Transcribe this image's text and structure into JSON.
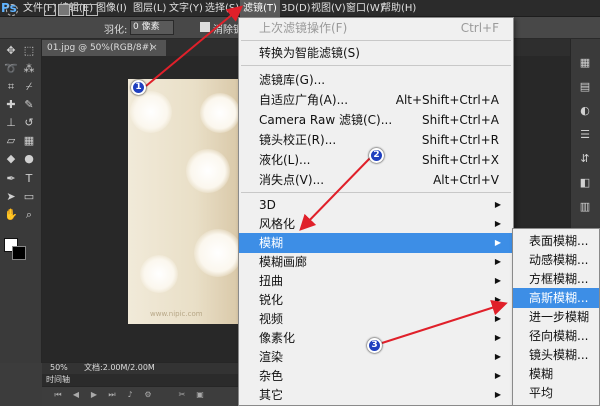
{
  "app": {
    "logo": "Ps"
  },
  "menubar": {
    "items": [
      "文件(F)",
      "编辑(E)",
      "图像(I)",
      "图层(L)",
      "文字(Y)",
      "选择(S)",
      "滤镜(T)",
      "3D(D)",
      "视图(V)",
      "窗口(W)",
      "帮助(H)"
    ]
  },
  "options": {
    "feather_label": "羽化:",
    "feather_value": "0 像素",
    "anti_alias_label": "消除锯齿"
  },
  "document_tab": {
    "title": "01.jpg @ 50%(RGB/8#)",
    "close": "×"
  },
  "status": {
    "zoom": "50%",
    "doc_size": "文档:2.00M/2.00M"
  },
  "timeline": {
    "label": "时间轴"
  },
  "watermark": "www.nipic.com",
  "filter_menu": {
    "items": [
      {
        "label": "上次滤镜操作(F)",
        "shortcut": "Ctrl+F",
        "disabled": true
      },
      {
        "label": "转换为智能滤镜(S)"
      },
      {
        "label": "滤镜库(G)..."
      },
      {
        "label": "自适应广角(A)...",
        "shortcut": "Alt+Shift+Ctrl+A"
      },
      {
        "label": "Camera Raw 滤镜(C)...",
        "shortcut": "Shift+Ctrl+A"
      },
      {
        "label": "镜头校正(R)...",
        "shortcut": "Shift+Ctrl+R"
      },
      {
        "label": "液化(L)...",
        "shortcut": "Shift+Ctrl+X"
      },
      {
        "label": "消失点(V)...",
        "shortcut": "Alt+Ctrl+V"
      },
      {
        "label": "3D"
      },
      {
        "label": "风格化"
      },
      {
        "label": "模糊"
      },
      {
        "label": "模糊画廊"
      },
      {
        "label": "扭曲"
      },
      {
        "label": "锐化"
      },
      {
        "label": "视频"
      },
      {
        "label": "像素化"
      },
      {
        "label": "渲染"
      },
      {
        "label": "杂色"
      },
      {
        "label": "其它"
      }
    ]
  },
  "blur_submenu": {
    "items": [
      "表面模糊...",
      "动感模糊...",
      "方框模糊...",
      "高斯模糊...",
      "进一步模糊",
      "径向模糊...",
      "镜头模糊...",
      "模糊",
      "平均"
    ]
  },
  "annotations": [
    "1",
    "2",
    "3"
  ],
  "colors": {
    "highlight": "#3d8ee6",
    "arrow": "#e0202a",
    "badge": "#1f3fbf"
  },
  "icons": {
    "submenu_arrow": "chevron-right-icon",
    "tools": [
      "move-icon",
      "marquee-icon",
      "lasso-icon",
      "magic-wand-icon",
      "crop-icon",
      "eyedropper-icon",
      "heal-icon",
      "brush-icon",
      "stamp-icon",
      "history-brush-icon",
      "eraser-icon",
      "gradient-icon",
      "blur-tool-icon",
      "dodge-icon",
      "pen-icon",
      "text-icon",
      "path-select-icon",
      "shape-icon",
      "hand-icon",
      "zoom-icon"
    ]
  }
}
